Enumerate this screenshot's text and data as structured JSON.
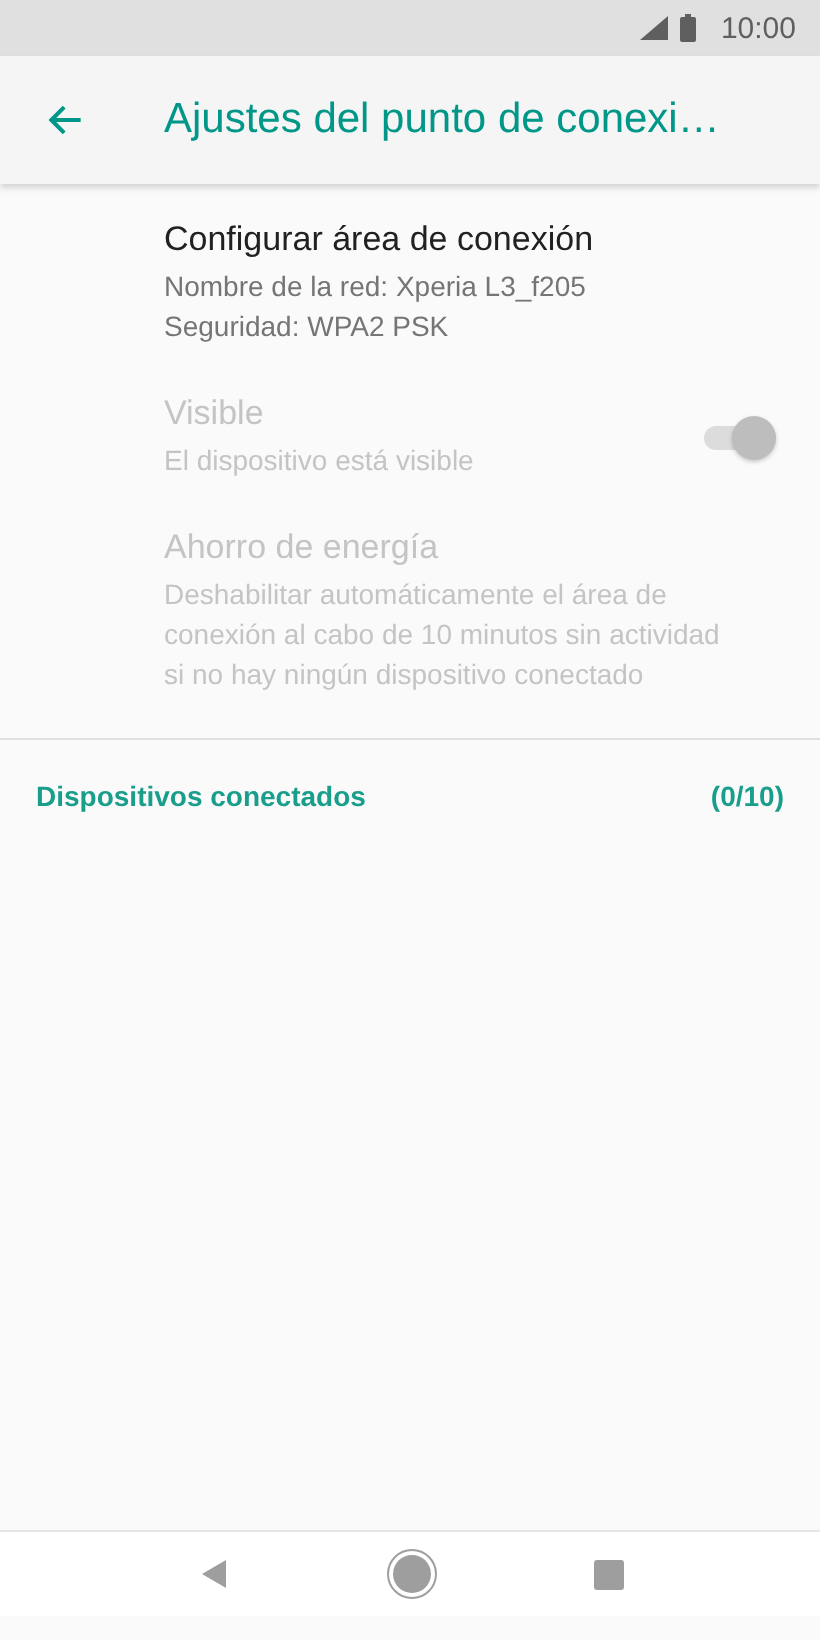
{
  "status_bar": {
    "time": "10:00"
  },
  "app_bar": {
    "title": "Ajustes del punto de conexi…"
  },
  "settings": [
    {
      "kind": "text",
      "title": "Configurar área de conexión",
      "lines": [
        "Nombre de la red: Xperia L3_f205",
        "Seguridad: WPA2 PSK"
      ],
      "disabled": false
    },
    {
      "kind": "switch",
      "title": "Visible",
      "lines": [
        "El dispositivo está visible"
      ],
      "disabled": true,
      "on": true
    },
    {
      "kind": "text",
      "title": "Ahorro de energía",
      "lines": [
        "Deshabilitar automáticamente el área de conexión al cabo de 10 minutos sin actividad si no hay ningún dispositivo conectado"
      ],
      "disabled": true
    }
  ],
  "section": {
    "title": "Dispositivos conectados",
    "count": "(0/10)"
  }
}
